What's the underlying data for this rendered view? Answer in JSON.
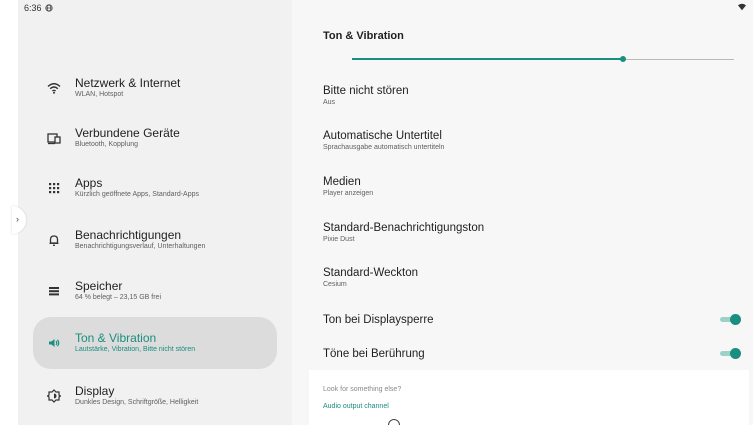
{
  "status_bar": {
    "time": "6:36"
  },
  "sidebar": {
    "items": [
      {
        "title": "Netzwerk & Internet",
        "subtitle": "WLAN, Hotspot",
        "icon": "wifi-icon"
      },
      {
        "title": "Verbundene Geräte",
        "subtitle": "Bluetooth, Kopplung",
        "icon": "devices-icon"
      },
      {
        "title": "Apps",
        "subtitle": "Kürzlich geöffnete Apps, Standard-Apps",
        "icon": "apps-grid-icon"
      },
      {
        "title": "Benachrichtigungen",
        "subtitle": "Benachrichtigungsverlauf, Unterhaltungen",
        "icon": "bell-icon"
      },
      {
        "title": "Speicher",
        "subtitle": "64 % belegt – 23,15 GB frei",
        "icon": "storage-icon"
      },
      {
        "title": "Ton & Vibration",
        "subtitle": "Lautstärke, Vibration, Bitte nicht stören",
        "icon": "volume-icon"
      },
      {
        "title": "Display",
        "subtitle": "Dunkles Design, Schriftgröße, Helligkeit",
        "icon": "brightness-icon"
      }
    ],
    "active_index": 5
  },
  "main": {
    "title": "Ton & Vibration",
    "scroll_progress": 0.71,
    "settings": [
      {
        "title": "Bitte nicht stören",
        "subtitle": "Aus"
      },
      {
        "title": "Automatische Untertitel",
        "subtitle": "Sprachausgabe automatisch untertiteln"
      },
      {
        "title": "Medien",
        "subtitle": "Player anzeigen"
      },
      {
        "title": "Standard-Benachrichtigungston",
        "subtitle": "Pixie Dust"
      },
      {
        "title": "Standard-Weckton",
        "subtitle": "Cesium"
      }
    ],
    "toggles": [
      {
        "title": "Ton bei Displaysperre",
        "on": true
      },
      {
        "title": "Töne bei Berührung",
        "on": true
      }
    ],
    "suggestions": {
      "label": "Look for something else?",
      "link": "Audio output channel"
    }
  },
  "colors": {
    "accent": "#1a8e7f",
    "sidebar_bg": "#f1f1f1",
    "content_bg": "#f7f7f7",
    "active_bg": "#dcdcdc"
  }
}
